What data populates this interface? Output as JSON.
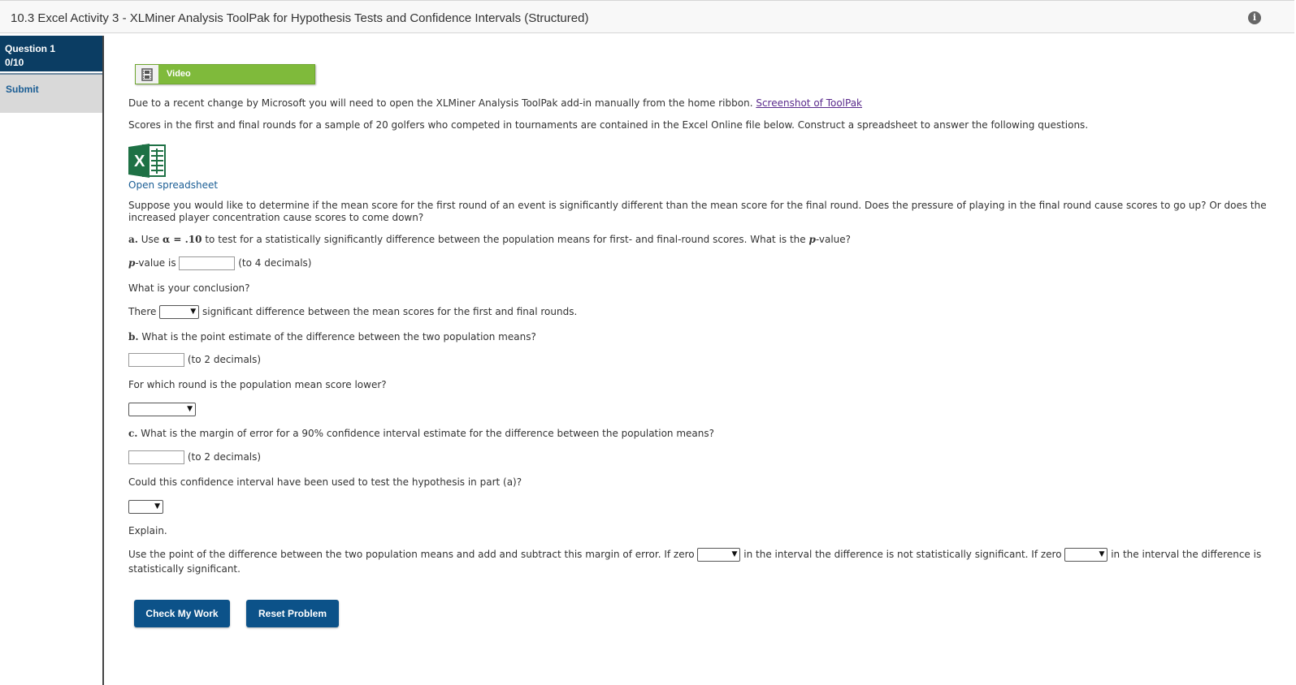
{
  "header": {
    "title": "10.3 Excel Activity 3 - XLMiner Analysis ToolPak for Hypothesis Tests and Confidence Intervals (Structured)",
    "info_icon": "i"
  },
  "sidebar": {
    "question_label": "Question 1",
    "score": "0/10",
    "submit_label": "Submit"
  },
  "video": {
    "label": "Video",
    "icon": "film-icon"
  },
  "intro": {
    "notice": "Due to a recent change by Microsoft you will need to open the XLMiner Analysis ToolPak add-in manually from the home ribbon.",
    "toolpak_link": "Screenshot of ToolPak",
    "scores_text": "Scores in the first and final rounds for a sample of 20 golfers who competed in tournaments are contained in the Excel Online file below. Construct a spreadsheet to answer the following questions.",
    "open_spreadsheet": "Open spreadsheet",
    "suppose_line1": "Suppose you would like to determine if the mean score for the first round of an event is significantly different than the mean score for the final round. Does the pressure of playing in the final round cause scores to go up? Or does the",
    "suppose_line2": "increased player concentration cause scores to come down?"
  },
  "part_a": {
    "prefix": "a.",
    "text1": " Use ",
    "alpha": "α = .10",
    "text2": " to test for a statistically significantly difference between the population means for first- and final-round scores. What is the ",
    "p": "p",
    "text3": "-value?",
    "pvalue_p": "p",
    "pvalue_label": "-value is",
    "pvalue_hint": "(to 4 decimals)",
    "conclusion_q": "What is your conclusion?",
    "there": "There",
    "there_rest": "significant difference between the mean scores for the first and final rounds."
  },
  "part_b": {
    "prefix": "b.",
    "question": " What is the point estimate of the difference between the two population means?",
    "hint": "(to 2 decimals)",
    "lower_q": "For which round is the population mean score lower?"
  },
  "part_c": {
    "prefix": "c.",
    "question": " What is the margin of error for a 90% confidence interval estimate for the difference between the population means?",
    "hint": "(to 2 decimals)",
    "could_q": "Could this confidence interval have been used to test the hypothesis in part (a)?",
    "explain": "Explain.",
    "explain_1": "Use the point of the difference between the two population means and add and subtract this margin of error. If zero",
    "explain_2": "in the interval the difference is not statistically significant. If zero",
    "explain_3": "in the interval the difference is",
    "explain_4": "statistically significant."
  },
  "buttons": {
    "check": "Check My Work",
    "reset": "Reset Problem"
  }
}
